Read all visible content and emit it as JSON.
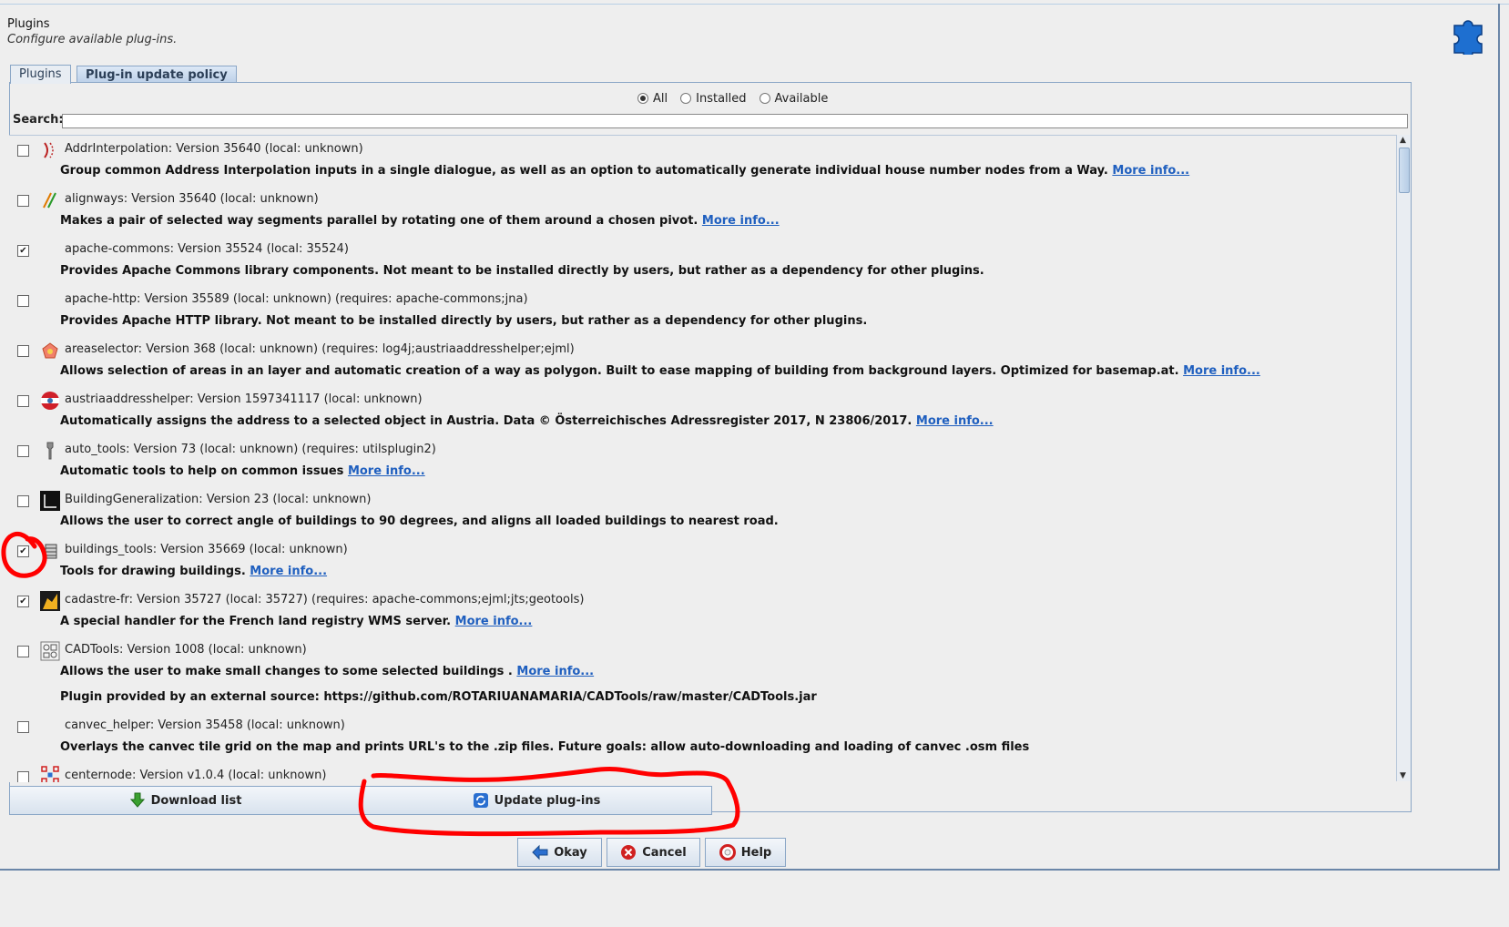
{
  "header": {
    "title": "Plugins",
    "subtitle": "Configure available plug-ins.",
    "icon": "puzzle-piece-icon"
  },
  "tabs": [
    {
      "label": "Plugins",
      "active": true
    },
    {
      "label": "Plug-in update policy",
      "active": false
    }
  ],
  "filter": {
    "options": [
      "All",
      "Installed",
      "Available"
    ],
    "selected": "All"
  },
  "search": {
    "label": "Search:",
    "value": ""
  },
  "plugins": [
    {
      "title": "AddrInterpolation: Version 35640 (local: unknown)",
      "desc": "Group common Address Interpolation inputs in a single dialogue, as well as an option to automatically generate individual house number nodes from a Way.",
      "more": "More info...",
      "checked": false,
      "icon": "addr-interpolation-icon"
    },
    {
      "title": "alignways: Version 35640 (local: unknown)",
      "desc": "Makes a pair of selected way segments parallel by rotating one of them around a chosen pivot.",
      "more": "More info...",
      "checked": false,
      "icon": "alignways-icon"
    },
    {
      "title": "apache-commons: Version 35524 (local: 35524)",
      "desc": "Provides Apache Commons library components. Not meant to be installed directly by users, but rather as a dependency for other plugins.",
      "more": "",
      "checked": true,
      "icon": ""
    },
    {
      "title": "apache-http: Version 35589 (local: unknown) (requires: apache-commons;jna)",
      "desc": "Provides Apache HTTP library. Not meant to be installed directly by users, but rather as a dependency for other plugins.",
      "more": "",
      "checked": false,
      "icon": ""
    },
    {
      "title": "areaselector: Version 368 (local: unknown) (requires: log4j;austriaaddresshelper;ejml)",
      "desc": "Allows selection of areas in an layer and automatic creation of a way as polygon. Built to ease mapping of building from background layers. Optimized for basemap.at.",
      "more": "More info...",
      "checked": false,
      "icon": "areaselector-icon"
    },
    {
      "title": "austriaaddresshelper: Version 1597341117 (local: unknown)",
      "desc": "Automatically assigns the address to a selected object in Austria. Data © Österreichisches Adressregister 2017, N 23806/2017.",
      "more": "More info...",
      "checked": false,
      "icon": "austria-flag-icon"
    },
    {
      "title": "auto_tools: Version 73 (local: unknown) (requires: utilsplugin2)",
      "desc": "Automatic tools to help on common issues",
      "more": "More info...",
      "checked": false,
      "icon": "wrench-icon"
    },
    {
      "title": "BuildingGeneralization: Version 23 (local: unknown)",
      "desc": "Allows the user to correct angle of buildings to 90 degrees, and aligns all loaded buildings to nearest road.",
      "more": "",
      "checked": false,
      "icon": "building-generalization-icon"
    },
    {
      "title": "buildings_tools: Version 35669 (local: unknown)",
      "desc": "Tools for drawing buildings.",
      "more": "More info...",
      "checked": true,
      "icon": "buildings-tools-icon"
    },
    {
      "title": "cadastre-fr: Version 35727 (local: 35727) (requires: apache-commons;ejml;jts;geotools)",
      "desc": "A special handler for the French land registry WMS server.",
      "more": "More info...",
      "checked": true,
      "icon": "cadastre-fr-icon"
    },
    {
      "title": "CADTools: Version 1008 (local: unknown)",
      "desc": "Allows the user to make small changes to some selected buildings .",
      "more": "More info...",
      "checked": false,
      "icon": "cadtools-icon",
      "extra": "Plugin provided by an external source: https://github.com/ROTARIUANAMARIA/CADTools/raw/master/CADTools.jar"
    },
    {
      "title": "canvec_helper: Version 35458 (local: unknown)",
      "desc": "Overlays the canvec tile grid on the map and prints URL's to the .zip files. Future goals: allow auto-downloading and loading of canvec .osm files",
      "more": "",
      "checked": false,
      "icon": ""
    },
    {
      "title": "centernode: Version v1.0.4 (local: unknown)",
      "desc": "",
      "more": "",
      "checked": false,
      "icon": "centernode-icon"
    }
  ],
  "buttons": {
    "download": "Download list",
    "update": "Update plug-ins",
    "okay": "Okay",
    "cancel": "Cancel",
    "help": "Help"
  },
  "colors": {
    "link": "#1f5fbf",
    "annotation": "#ff0000",
    "accent": "#8aa6c6"
  }
}
